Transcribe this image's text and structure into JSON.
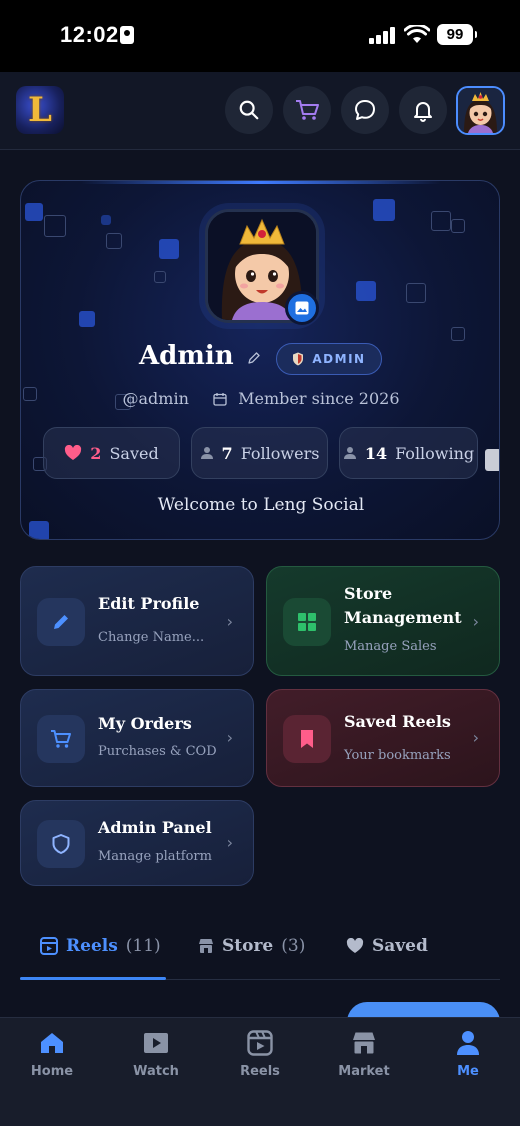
{
  "status_bar": {
    "time": "12:02",
    "battery": "99"
  },
  "header": {
    "logo_letter": "L",
    "icons": [
      "search-icon",
      "cart-icon",
      "chat-icon",
      "bell-icon"
    ]
  },
  "profile": {
    "name": "Admin",
    "role_badge": "ADMIN",
    "handle": "@admin",
    "member_since": "Member since 2026",
    "stats": [
      {
        "count": "2",
        "label": "Saved"
      },
      {
        "count": "7",
        "label": "Followers"
      },
      {
        "count": "14",
        "label": "Following"
      }
    ],
    "welcome": "Welcome to Leng Social"
  },
  "actions": [
    {
      "title": "Edit Profile",
      "subtitle": "Change Name...",
      "color": "blue",
      "icon": "pencil-icon"
    },
    {
      "title": "Store Management",
      "subtitle": "Manage Sales",
      "color": "green",
      "icon": "grid-icon"
    },
    {
      "title": "My Orders",
      "subtitle": "Purchases & COD",
      "color": "blue",
      "icon": "cart-icon"
    },
    {
      "title": "Saved Reels",
      "subtitle": "Your bookmarks",
      "color": "red",
      "icon": "bookmark-icon"
    },
    {
      "title": "Admin Panel",
      "subtitle": "Manage platform",
      "color": "blue",
      "icon": "shield-icon"
    }
  ],
  "tabs": [
    {
      "label": "Reels",
      "count": "(11)",
      "active": true
    },
    {
      "label": "Store",
      "count": "(3)",
      "active": false
    },
    {
      "label": "Saved",
      "count": "",
      "active": false
    }
  ],
  "bottom_nav": [
    {
      "label": "Home",
      "active": false
    },
    {
      "label": "Watch",
      "active": false
    },
    {
      "label": "Reels",
      "active": false
    },
    {
      "label": "Market",
      "active": false
    },
    {
      "label": "Me",
      "active": true
    }
  ],
  "colors": {
    "accent": "#3d86f5",
    "heart": "#ff5d8a",
    "background": "#0e1220"
  }
}
